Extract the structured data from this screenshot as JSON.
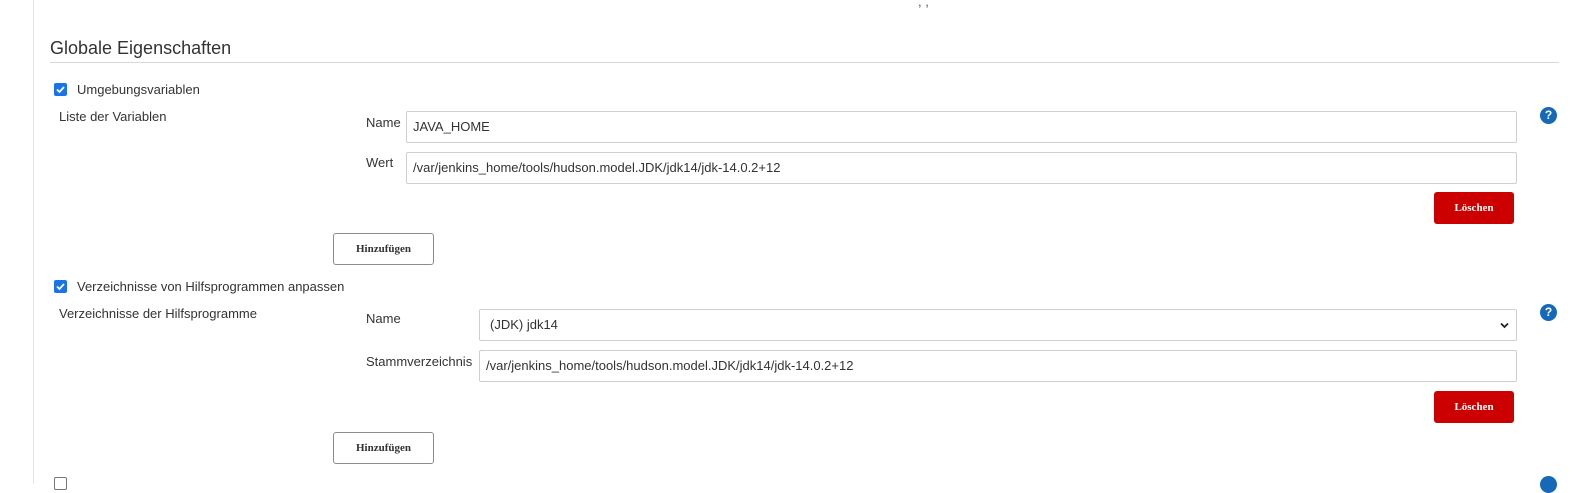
{
  "top_fragment": ", ,",
  "section": {
    "title": "Globale Eigenschaften"
  },
  "env_vars": {
    "checkbox_label": "Umgebungsvariablen",
    "list_label": "Liste der Variablen",
    "name_label": "Name",
    "name_value": "JAVA_HOME",
    "value_label": "Wert",
    "value_value": "/var/jenkins_home/tools/hudson.model.JDK/jdk14/jdk-14.0.2+12",
    "delete_label": "Löschen",
    "add_label": "Hinzufügen",
    "help_label": "?"
  },
  "tool_locations": {
    "checkbox_label": "Verzeichnisse von Hilfsprogrammen anpassen",
    "list_label": "Verzeichnisse der Hilfsprogramme",
    "name_label": "Name",
    "name_selected": "(JDK) jdk14",
    "home_label": "Stammverzeichnis",
    "home_value": "/var/jenkins_home/tools/hudson.model.JDK/jdk14/jdk-14.0.2+12",
    "delete_label": "Löschen",
    "add_label": "Hinzufügen",
    "help_label": "?"
  },
  "colors": {
    "accent_blue": "#1a73e8",
    "help_blue": "#1669b8",
    "delete_red": "#cc0000"
  }
}
